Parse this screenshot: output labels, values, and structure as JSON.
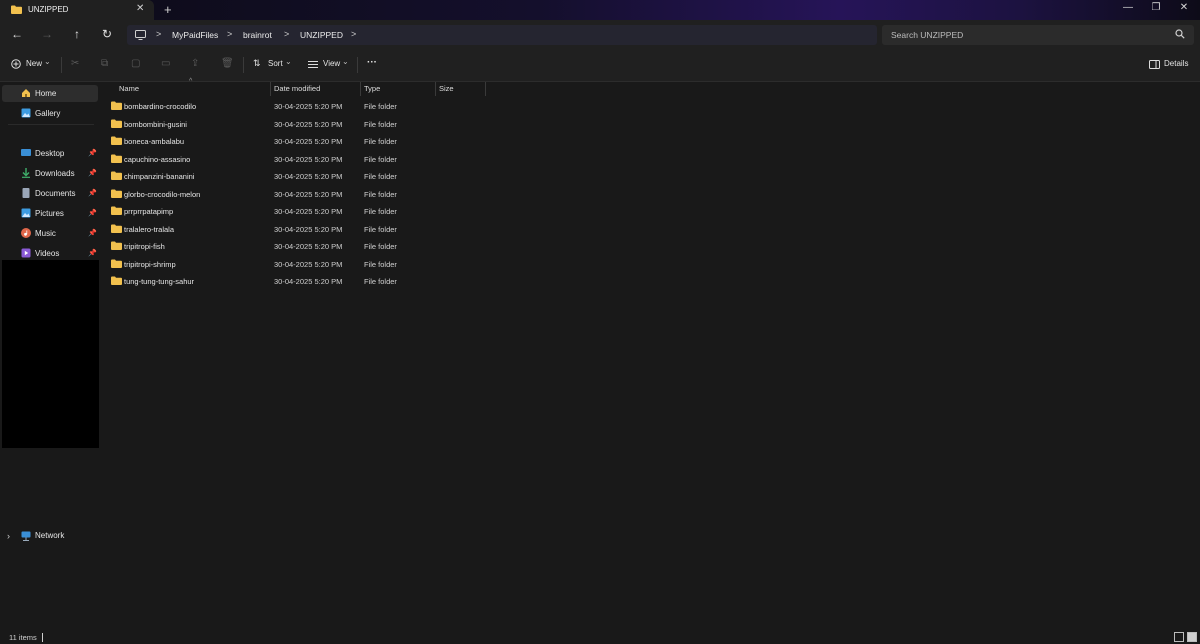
{
  "window": {
    "tab_title": "UNZIPPED",
    "tab_close_glyph": "✕",
    "new_tab_glyph": "+",
    "minimize_glyph": "—",
    "restore_glyph": "❐",
    "close_glyph": "✕"
  },
  "address": {
    "back_glyph": "←",
    "forward_glyph": "→",
    "up_glyph": "↑",
    "refresh_glyph": "↻",
    "crumbs": [
      "MyPaidFiles",
      "brainrot",
      "UNZIPPED"
    ],
    "sep_glyph": ">"
  },
  "search": {
    "placeholder": "Search UNZIPPED"
  },
  "toolbar": {
    "new_label": "New",
    "sort_label": "Sort",
    "view_label": "View",
    "more_glyph": "···",
    "details_label": "Details",
    "chevron": "⌄"
  },
  "sidebar": {
    "home": "Home",
    "gallery": "Gallery",
    "pinned": [
      {
        "label": "Desktop",
        "icon": "desktop-icon",
        "color": "#3a8fd6"
      },
      {
        "label": "Downloads",
        "icon": "download-icon",
        "color": "#3fae6a"
      },
      {
        "label": "Documents",
        "icon": "documents-icon",
        "color": "#9aa6b8"
      },
      {
        "label": "Pictures",
        "icon": "pictures-icon",
        "color": "#3d9be0"
      },
      {
        "label": "Music",
        "icon": "music-icon",
        "color": "#e0674a"
      },
      {
        "label": "Videos",
        "icon": "videos-icon",
        "color": "#8a5ad6"
      }
    ],
    "network": "Network",
    "pin_glyph": "📌"
  },
  "columns": {
    "name": "Name",
    "date": "Date modified",
    "type": "Type",
    "size": "Size"
  },
  "files": [
    {
      "name": "bombardino-crocodilo",
      "date": "30-04-2025 5:20 PM",
      "type": "File folder"
    },
    {
      "name": "bombombini-gusini",
      "date": "30-04-2025 5:20 PM",
      "type": "File folder"
    },
    {
      "name": "boneca-ambalabu",
      "date": "30-04-2025 5:20 PM",
      "type": "File folder"
    },
    {
      "name": "capuchino-assasino",
      "date": "30-04-2025 5:20 PM",
      "type": "File folder"
    },
    {
      "name": "chimpanzini-bananini",
      "date": "30-04-2025 5:20 PM",
      "type": "File folder"
    },
    {
      "name": "glorbo-crocodilo-melon",
      "date": "30-04-2025 5:20 PM",
      "type": "File folder"
    },
    {
      "name": "prrprrpatapimp",
      "date": "30-04-2025 5:20 PM",
      "type": "File folder"
    },
    {
      "name": "tralalero-tralala",
      "date": "30-04-2025 5:20 PM",
      "type": "File folder"
    },
    {
      "name": "tripitropi-fish",
      "date": "30-04-2025 5:20 PM",
      "type": "File folder"
    },
    {
      "name": "tripitropi-shrimp",
      "date": "30-04-2025 5:20 PM",
      "type": "File folder"
    },
    {
      "name": "tung-tung-tung-sahur",
      "date": "30-04-2025 5:20 PM",
      "type": "File folder"
    }
  ],
  "status": {
    "item_count": "11 items"
  },
  "colors": {
    "folder": "#f2c14e",
    "accent": "#2a2250"
  }
}
